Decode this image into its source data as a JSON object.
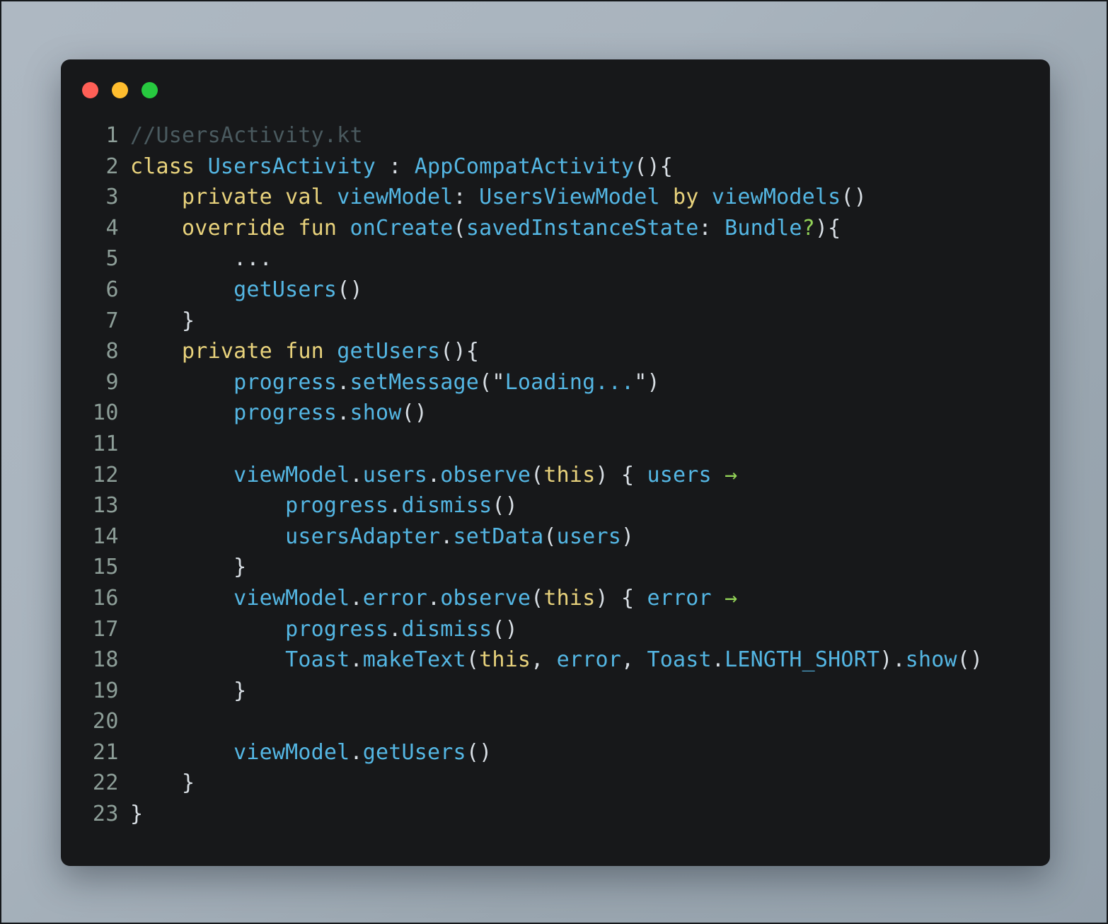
{
  "window": {
    "controls": [
      {
        "name": "close",
        "color": "#ff5f56"
      },
      {
        "name": "minimize",
        "color": "#ffbd2e"
      },
      {
        "name": "zoom",
        "color": "#27c93f"
      }
    ],
    "background_color": "#17181a",
    "page_background": "#a9b4be"
  },
  "editor": {
    "language": "kotlin",
    "filename": "UsersActivity.kt",
    "theme_colors": {
      "comment": "#4a5a5f",
      "keyword": "#e8d27c",
      "identifier": "#54b6e3",
      "punctuation": "#d8dee4",
      "operator_green": "#92d257",
      "line_number": "#8d9e98"
    },
    "lines": [
      {
        "n": "1",
        "tokens": [
          {
            "c": "comment",
            "t": "//UsersActivity.kt"
          }
        ]
      },
      {
        "n": "2",
        "tokens": [
          {
            "c": "keyword",
            "t": "class"
          },
          {
            "c": "plain",
            "t": " "
          },
          {
            "c": "ident",
            "t": "UsersActivity"
          },
          {
            "c": "punct",
            "t": " : "
          },
          {
            "c": "ident",
            "t": "AppCompatActivity"
          },
          {
            "c": "punct",
            "t": "(){"
          }
        ]
      },
      {
        "n": "3",
        "tokens": [
          {
            "c": "plain",
            "t": "    "
          },
          {
            "c": "keyword",
            "t": "private val"
          },
          {
            "c": "plain",
            "t": " "
          },
          {
            "c": "ident",
            "t": "viewModel"
          },
          {
            "c": "punct",
            "t": ": "
          },
          {
            "c": "ident",
            "t": "UsersViewModel"
          },
          {
            "c": "plain",
            "t": " "
          },
          {
            "c": "keyword",
            "t": "by"
          },
          {
            "c": "plain",
            "t": " "
          },
          {
            "c": "ident",
            "t": "viewModels"
          },
          {
            "c": "punct",
            "t": "()"
          }
        ]
      },
      {
        "n": "4",
        "tokens": [
          {
            "c": "plain",
            "t": "    "
          },
          {
            "c": "keyword",
            "t": "override fun"
          },
          {
            "c": "plain",
            "t": " "
          },
          {
            "c": "ident",
            "t": "onCreate"
          },
          {
            "c": "punct",
            "t": "("
          },
          {
            "c": "ident",
            "t": "savedInstanceState"
          },
          {
            "c": "punct",
            "t": ": "
          },
          {
            "c": "ident",
            "t": "Bundle"
          },
          {
            "c": "green",
            "t": "?"
          },
          {
            "c": "punct",
            "t": "){"
          }
        ]
      },
      {
        "n": "5",
        "tokens": [
          {
            "c": "plain",
            "t": "        ..."
          }
        ]
      },
      {
        "n": "6",
        "tokens": [
          {
            "c": "plain",
            "t": "        "
          },
          {
            "c": "ident",
            "t": "getUsers"
          },
          {
            "c": "punct",
            "t": "()"
          }
        ]
      },
      {
        "n": "7",
        "tokens": [
          {
            "c": "punct",
            "t": "    }"
          }
        ]
      },
      {
        "n": "8",
        "tokens": [
          {
            "c": "plain",
            "t": "    "
          },
          {
            "c": "keyword",
            "t": "private fun"
          },
          {
            "c": "plain",
            "t": " "
          },
          {
            "c": "ident",
            "t": "getUsers"
          },
          {
            "c": "punct",
            "t": "(){"
          }
        ]
      },
      {
        "n": "9",
        "tokens": [
          {
            "c": "plain",
            "t": "        "
          },
          {
            "c": "ident",
            "t": "progress"
          },
          {
            "c": "punct",
            "t": "."
          },
          {
            "c": "ident",
            "t": "setMessage"
          },
          {
            "c": "punct",
            "t": "(\""
          },
          {
            "c": "ident",
            "t": "Loading..."
          },
          {
            "c": "punct",
            "t": "\")"
          }
        ]
      },
      {
        "n": "10",
        "tokens": [
          {
            "c": "plain",
            "t": "        "
          },
          {
            "c": "ident",
            "t": "progress"
          },
          {
            "c": "punct",
            "t": "."
          },
          {
            "c": "ident",
            "t": "show"
          },
          {
            "c": "punct",
            "t": "()"
          }
        ]
      },
      {
        "n": "11",
        "tokens": [
          {
            "c": "plain",
            "t": ""
          }
        ]
      },
      {
        "n": "12",
        "tokens": [
          {
            "c": "plain",
            "t": "        "
          },
          {
            "c": "ident",
            "t": "viewModel"
          },
          {
            "c": "punct",
            "t": "."
          },
          {
            "c": "ident",
            "t": "users"
          },
          {
            "c": "punct",
            "t": "."
          },
          {
            "c": "ident",
            "t": "observe"
          },
          {
            "c": "punct",
            "t": "("
          },
          {
            "c": "keyword",
            "t": "this"
          },
          {
            "c": "punct",
            "t": ") { "
          },
          {
            "c": "ident",
            "t": "users"
          },
          {
            "c": "plain",
            "t": " "
          },
          {
            "c": "arrow",
            "t": "→"
          }
        ]
      },
      {
        "n": "13",
        "tokens": [
          {
            "c": "plain",
            "t": "            "
          },
          {
            "c": "ident",
            "t": "progress"
          },
          {
            "c": "punct",
            "t": "."
          },
          {
            "c": "ident",
            "t": "dismiss"
          },
          {
            "c": "punct",
            "t": "()"
          }
        ]
      },
      {
        "n": "14",
        "tokens": [
          {
            "c": "plain",
            "t": "            "
          },
          {
            "c": "ident",
            "t": "usersAdapter"
          },
          {
            "c": "punct",
            "t": "."
          },
          {
            "c": "ident",
            "t": "setData"
          },
          {
            "c": "punct",
            "t": "("
          },
          {
            "c": "ident",
            "t": "users"
          },
          {
            "c": "punct",
            "t": ")"
          }
        ]
      },
      {
        "n": "15",
        "tokens": [
          {
            "c": "punct",
            "t": "        }"
          }
        ]
      },
      {
        "n": "16",
        "tokens": [
          {
            "c": "plain",
            "t": "        "
          },
          {
            "c": "ident",
            "t": "viewModel"
          },
          {
            "c": "punct",
            "t": "."
          },
          {
            "c": "ident",
            "t": "error"
          },
          {
            "c": "punct",
            "t": "."
          },
          {
            "c": "ident",
            "t": "observe"
          },
          {
            "c": "punct",
            "t": "("
          },
          {
            "c": "keyword",
            "t": "this"
          },
          {
            "c": "punct",
            "t": ") { "
          },
          {
            "c": "ident",
            "t": "error"
          },
          {
            "c": "plain",
            "t": " "
          },
          {
            "c": "arrow",
            "t": "→"
          }
        ]
      },
      {
        "n": "17",
        "tokens": [
          {
            "c": "plain",
            "t": "            "
          },
          {
            "c": "ident",
            "t": "progress"
          },
          {
            "c": "punct",
            "t": "."
          },
          {
            "c": "ident",
            "t": "dismiss"
          },
          {
            "c": "punct",
            "t": "()"
          }
        ]
      },
      {
        "n": "18",
        "tokens": [
          {
            "c": "plain",
            "t": "            "
          },
          {
            "c": "ident",
            "t": "Toast"
          },
          {
            "c": "punct",
            "t": "."
          },
          {
            "c": "ident",
            "t": "makeText"
          },
          {
            "c": "punct",
            "t": "("
          },
          {
            "c": "keyword",
            "t": "this"
          },
          {
            "c": "punct",
            "t": ", "
          },
          {
            "c": "ident",
            "t": "error"
          },
          {
            "c": "punct",
            "t": ", "
          },
          {
            "c": "ident",
            "t": "Toast"
          },
          {
            "c": "punct",
            "t": "."
          },
          {
            "c": "ident",
            "t": "LENGTH_SHORT"
          },
          {
            "c": "punct",
            "t": ")."
          },
          {
            "c": "ident",
            "t": "show"
          },
          {
            "c": "punct",
            "t": "()"
          }
        ]
      },
      {
        "n": "19",
        "tokens": [
          {
            "c": "punct",
            "t": "        }"
          }
        ]
      },
      {
        "n": "20",
        "tokens": [
          {
            "c": "plain",
            "t": ""
          }
        ]
      },
      {
        "n": "21",
        "tokens": [
          {
            "c": "plain",
            "t": "        "
          },
          {
            "c": "ident",
            "t": "viewModel"
          },
          {
            "c": "punct",
            "t": "."
          },
          {
            "c": "ident",
            "t": "getUsers"
          },
          {
            "c": "punct",
            "t": "()"
          }
        ]
      },
      {
        "n": "22",
        "tokens": [
          {
            "c": "punct",
            "t": "    }"
          }
        ]
      },
      {
        "n": "23",
        "tokens": [
          {
            "c": "punct",
            "t": "}"
          }
        ]
      }
    ]
  }
}
